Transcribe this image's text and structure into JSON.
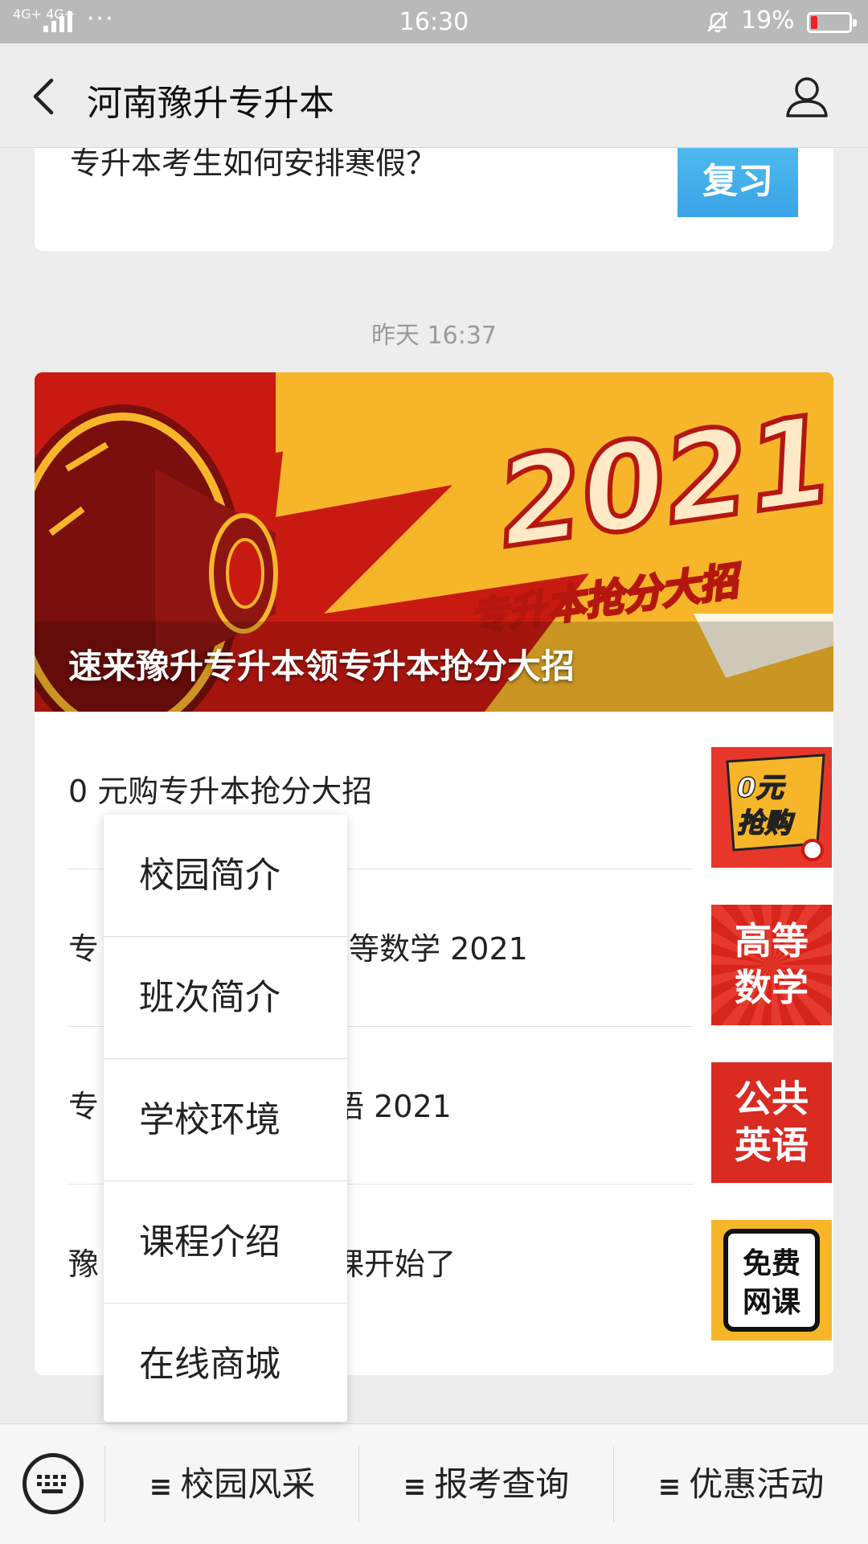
{
  "status_bar": {
    "network": "4G+ 4G+",
    "more": "···",
    "time": "16:30",
    "battery_percent": "19%",
    "battery_level": 0.19,
    "icons": [
      "signal-icon",
      "bell-muted-icon",
      "battery-icon"
    ]
  },
  "header": {
    "title": "河南豫升专升本",
    "icons": [
      "back-arrow-icon",
      "profile-icon"
    ]
  },
  "previous_article": {
    "title": "专升本考生如何安排寒假？",
    "thumb_text": "复习"
  },
  "timestamp": "昨天 16:37",
  "banner": {
    "caption": "速来豫升专升本领专升本抢分大招",
    "big_text": "2021",
    "sub_text": "专升本抢分大招"
  },
  "articles": [
    {
      "title": "0 元购专升本抢分大招",
      "thumb_line1": "0元",
      "thumb_line2": "抢购"
    },
    {
      "title": "专高等数学 2021",
      "visible_start": "专",
      "visible_end": "高等数学 2021",
      "thumb_line1": "高等",
      "thumb_line2": "数学"
    },
    {
      "title": "专语 2021",
      "visible_start": "专",
      "visible_end": "语 2021",
      "thumb_line1": "公共",
      "thumb_line2": "英语"
    },
    {
      "title": "豫课开始了",
      "visible_start": "豫",
      "visible_end": "课开始了",
      "thumb_line1": "免费",
      "thumb_line2": "网课"
    }
  ],
  "popup_menu": {
    "items": [
      "校园简介",
      "班次简介",
      "学校环境",
      "课程介绍",
      "在线商城"
    ]
  },
  "bottom_bar": {
    "keyboard_icon": "keyboard-icon",
    "tabs": [
      {
        "prefix": "≡",
        "label": "校园风采"
      },
      {
        "prefix": "≡",
        "label": "报考查询"
      },
      {
        "prefix": "≡",
        "label": "优惠活动"
      }
    ]
  },
  "colors": {
    "accent_red": "#c91a12",
    "banner_yellow": "#f7b62a",
    "thumb_blue": "#3ba3e6",
    "background": "#ededed"
  }
}
